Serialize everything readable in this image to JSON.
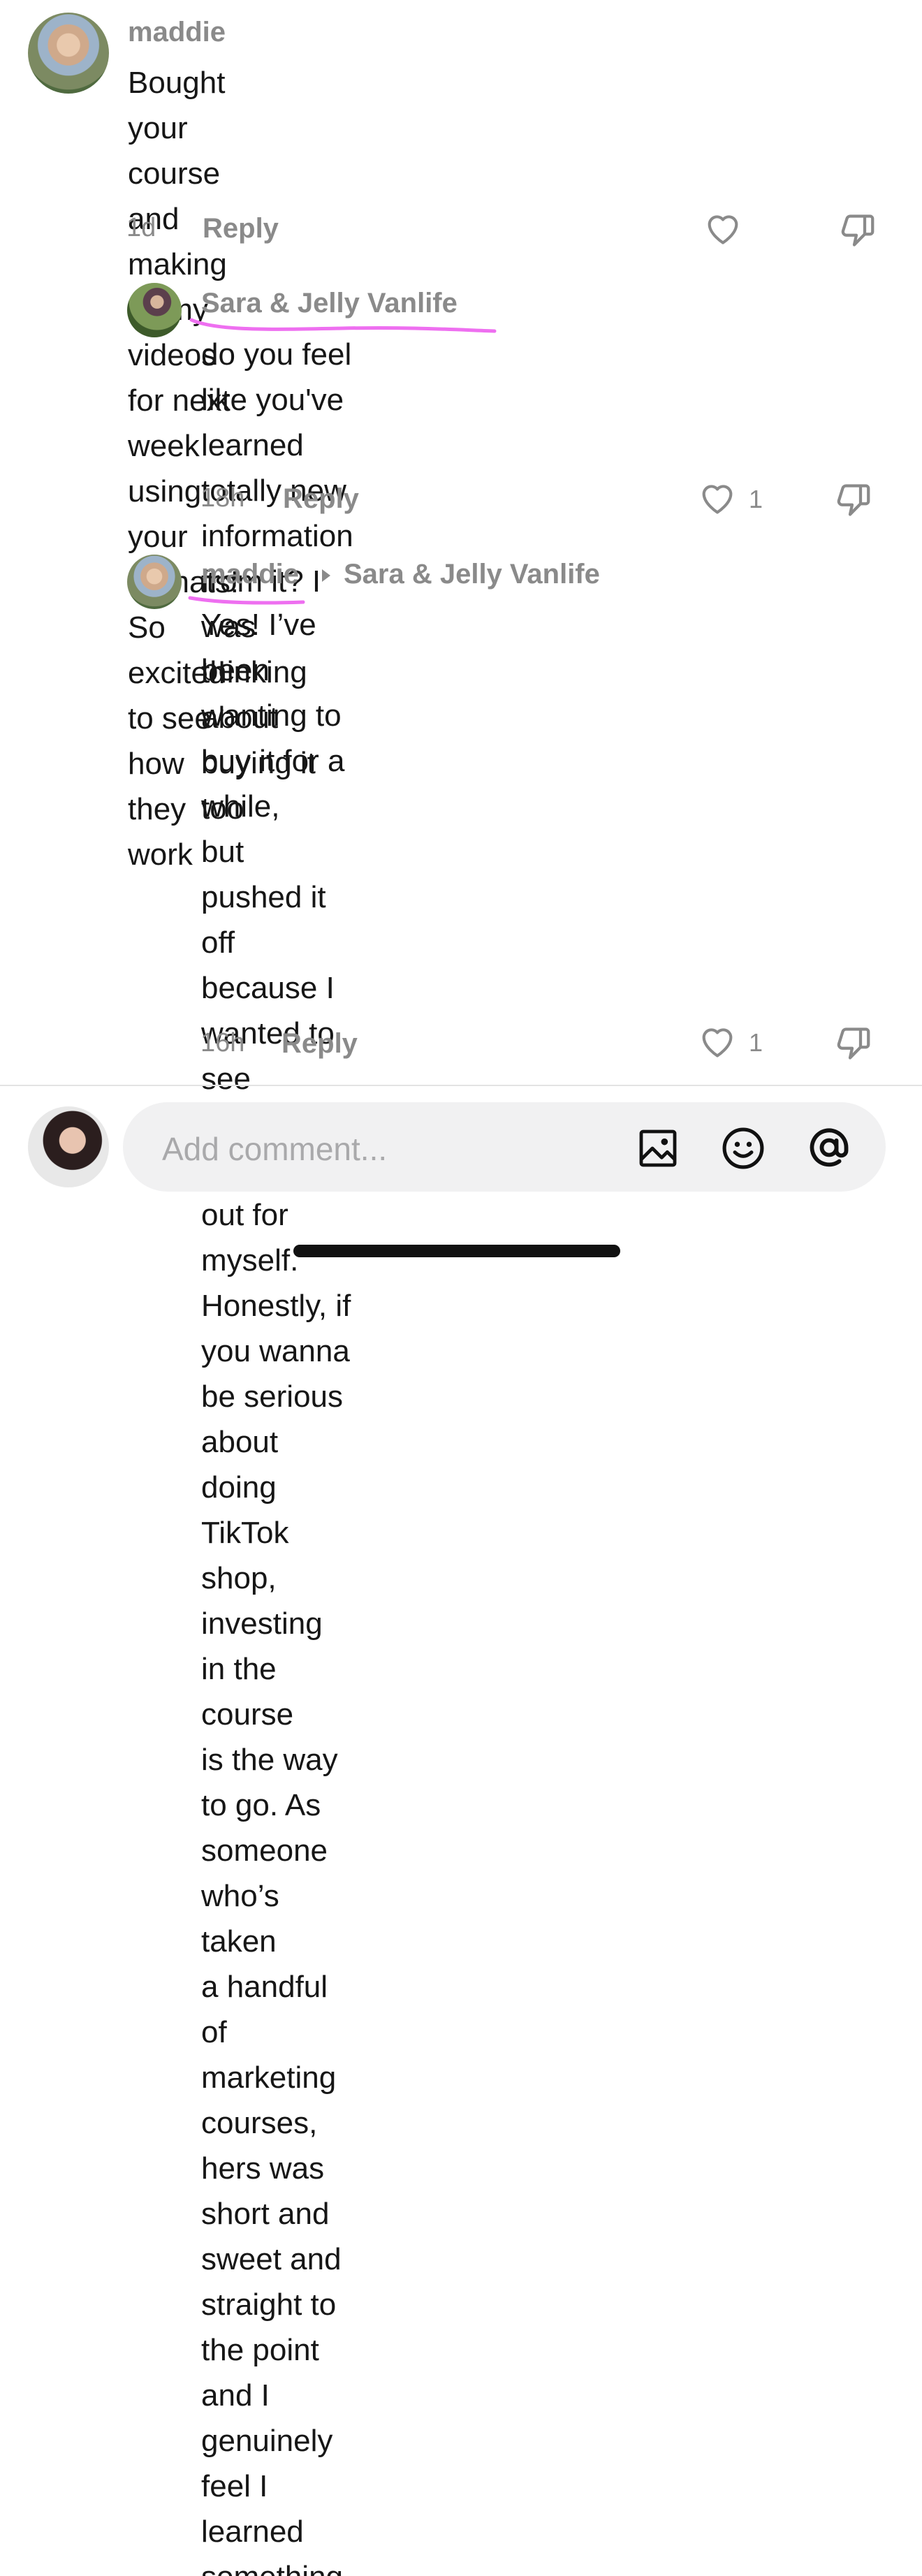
{
  "comments": [
    {
      "author": "maddie",
      "text": "Bought your course and making all my videos\nfor next week using your formats! So excited\nto see how they work",
      "time": "1d",
      "reply_label": "Reply",
      "likes": ""
    },
    {
      "author": "Sara & Jelly Vanlife",
      "text": "do you feel like you've learned totally new\ninformation from it? I was thinking about\nbuying it too",
      "time": "18h",
      "reply_label": "Reply",
      "likes": "1"
    },
    {
      "author": "maddie",
      "reply_to": "Sara & Jelly Vanlife",
      "text": "Yes! I’ve been wanting to buy it for a while,\nbut pushed it off because I wanted to see\nif I could figure this out for myself.\nHonestly, if you wanna be serious about\ndoing TikTok shop, investing in the course\nis the way to go. As someone who’s taken\na handful of marketing courses, hers was\nshort and sweet and straight to the point\nand I genuinely feel I learned something.",
      "time": "16h",
      "reply_label": "Reply",
      "likes": "1"
    }
  ],
  "composer": {
    "placeholder": "Add comment..."
  },
  "colors": {
    "annotation_underline": "#ee6ff0",
    "meta_gray": "#8a8a8a",
    "text": "#161616"
  }
}
